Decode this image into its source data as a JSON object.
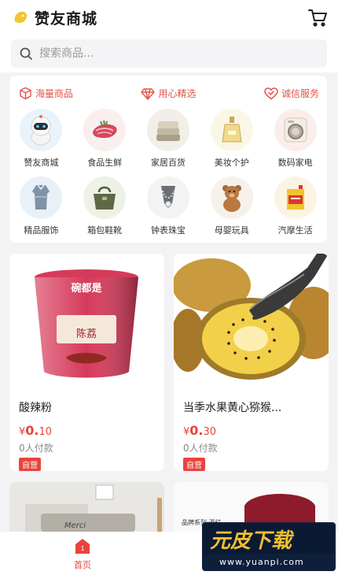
{
  "header": {
    "title": "赞友商城",
    "cart_icon": "cart-icon",
    "logo_icon": "yellow-leaf-logo"
  },
  "search": {
    "placeholder": "搜索商品..."
  },
  "features": [
    {
      "label": "海量商品",
      "icon": "box-icon"
    },
    {
      "label": "用心精选",
      "icon": "diamond-icon"
    },
    {
      "label": "诚信服务",
      "icon": "heart-icon"
    }
  ],
  "categories": [
    {
      "label": "赞友商城",
      "icon": "robot-icon"
    },
    {
      "label": "食品生鲜",
      "icon": "meat-icon"
    },
    {
      "label": "家居百货",
      "icon": "towels-icon"
    },
    {
      "label": "美妆个护",
      "icon": "perfume-icon"
    },
    {
      "label": "数码家电",
      "icon": "washing-machine-icon"
    },
    {
      "label": "精品服饰",
      "icon": "dress-icon"
    },
    {
      "label": "箱包鞋靴",
      "icon": "handbag-icon"
    },
    {
      "label": "钟表珠宝",
      "icon": "necklace-icon"
    },
    {
      "label": "母婴玩具",
      "icon": "teddy-bear-icon"
    },
    {
      "label": "汽摩生活",
      "icon": "motor-oil-icon"
    }
  ],
  "products": [
    {
      "name": "酸辣粉",
      "currency": "¥",
      "price_int": "0.",
      "price_dec": "10",
      "paid": "0人付款",
      "tag": "自营",
      "brand_text": "陈荔",
      "lid_text": "碗都是"
    },
    {
      "name": "当季水果黄心猕猴...",
      "currency": "¥",
      "price_int": "0.",
      "price_dec": "30",
      "paid": "0人付款",
      "tag": "自营"
    }
  ],
  "partial_cards": [
    {
      "wall_text": "Merci"
    },
    {
      "text": "品牌系列·酒红"
    }
  ],
  "tabbar": {
    "home_label": "首页",
    "home_badge": "1"
  },
  "watermark": {
    "main": "元皮下载",
    "url": "www.yuanpi.com"
  },
  "colors": {
    "accent": "#e8443d",
    "feature_red": "#e2524a",
    "logo_yellow": "#f5c431"
  }
}
